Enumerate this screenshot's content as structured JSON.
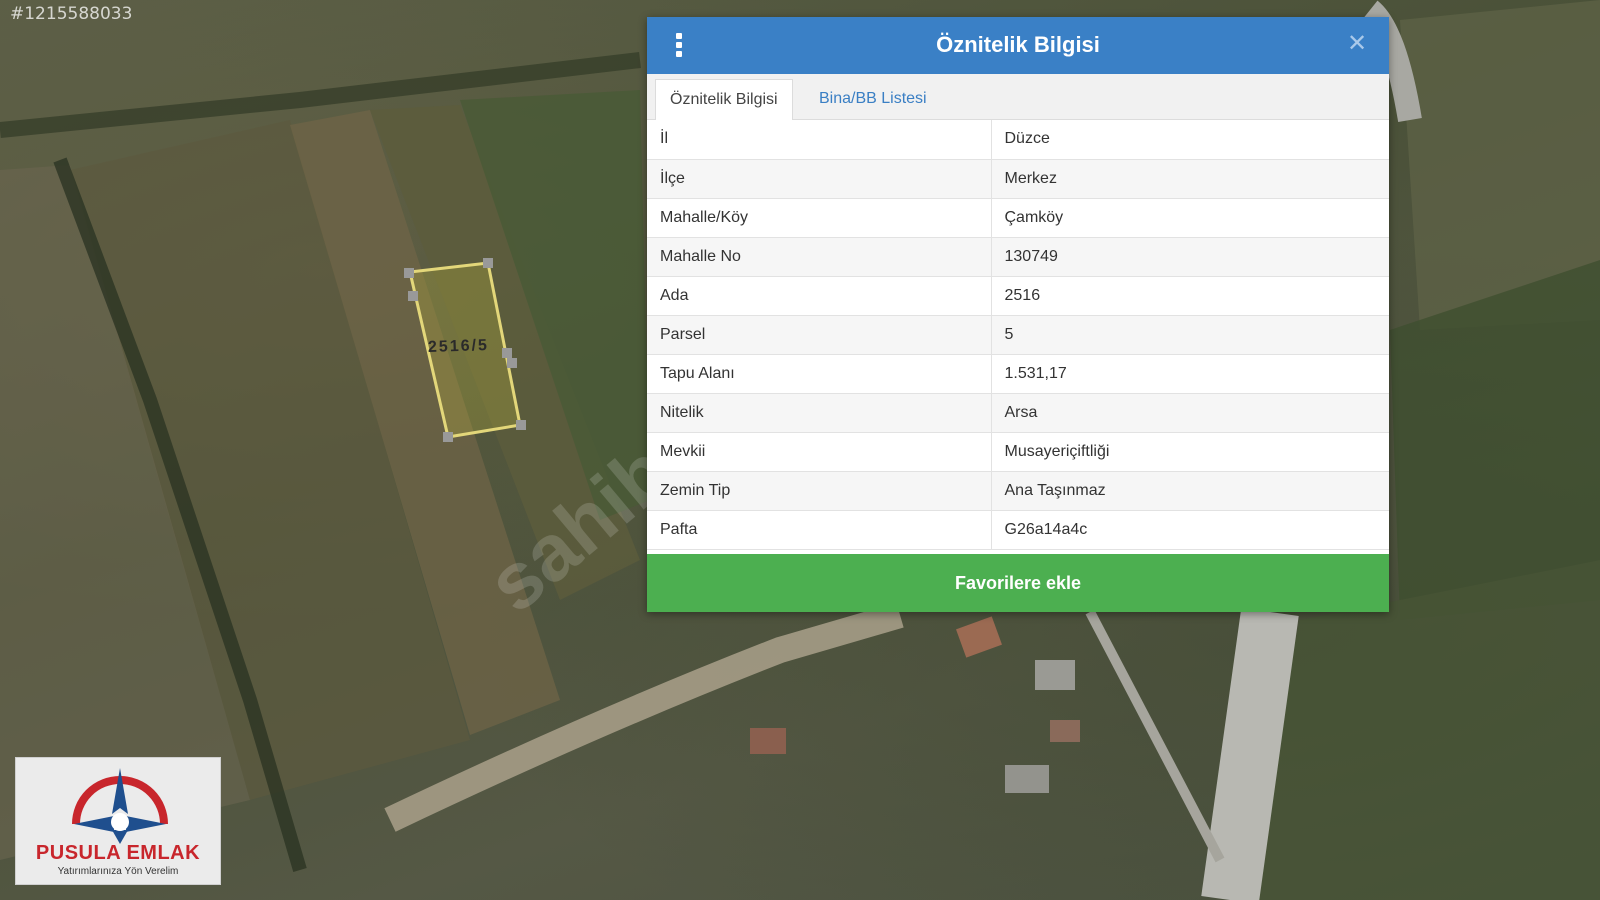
{
  "map": {
    "image_id": "#1215588033",
    "parcel_label": "2516/5",
    "watermark": "sahib"
  },
  "logo": {
    "name": "PUSULA EMLAK",
    "tagline": "Yatırımlarınıza Yön Verelim",
    "colors": {
      "primary": "#c8262c",
      "secondary": "#1f4f8e"
    }
  },
  "dialog": {
    "title": "Öznitelik Bilgisi",
    "header_color": "#3a80c6",
    "menu_icon": "vertical-dots-icon",
    "close_icon": "close-icon",
    "tabs": [
      {
        "label": "Öznitelik Bilgisi",
        "active": true
      },
      {
        "label": "Bina/BB Listesi",
        "active": false
      }
    ],
    "rows": [
      {
        "key": "İl",
        "value": "Düzce"
      },
      {
        "key": "İlçe",
        "value": "Merkez"
      },
      {
        "key": "Mahalle/Köy",
        "value": "Çamköy"
      },
      {
        "key": "Mahalle No",
        "value": "130749"
      },
      {
        "key": "Ada",
        "value": "2516"
      },
      {
        "key": "Parsel",
        "value": "5"
      },
      {
        "key": "Tapu Alanı",
        "value": "1.531,17"
      },
      {
        "key": "Nitelik",
        "value": "Arsa"
      },
      {
        "key": "Mevkii",
        "value": "Musayeriçiftliği"
      },
      {
        "key": "Zemin Tip",
        "value": "Ana Taşınmaz"
      },
      {
        "key": "Pafta",
        "value": "G26a14a4c"
      }
    ],
    "favorite_button": "Favorilere ekle",
    "favorite_color": "#4caf50"
  }
}
